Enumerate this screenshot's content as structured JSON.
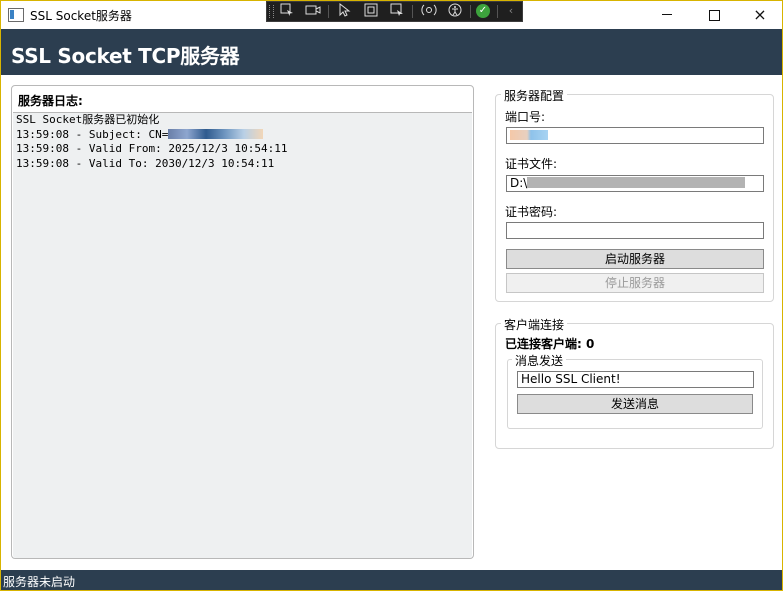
{
  "window": {
    "title": "SSL Socket服务器",
    "controls": {
      "minimize": "minimize-icon",
      "maximize": "maximize-icon",
      "close": "×"
    }
  },
  "debug_toolbar": {
    "icons": [
      "select-element-icon",
      "video-icon",
      "pointer-icon",
      "bounds-icon",
      "track-focus-icon",
      "hot-reload-icon",
      "accessibility-icon",
      "check-icon",
      "chevron-left-icon"
    ]
  },
  "header": {
    "title": "SSL Socket TCP服务器"
  },
  "log": {
    "label": "服务器日志:",
    "lines": [
      "SSL Socket服务器已初始化",
      "13:59:08 - Subject: CN=",
      "13:59:08 - Valid From: 2025/12/3 10:54:11",
      "13:59:08 - Valid To: 2030/12/3 10:54:11"
    ]
  },
  "server_config": {
    "title": "服务器配置",
    "port_label": "端口号:",
    "cert_file_label": "证书文件:",
    "cert_file_value": "D:\\",
    "cert_password_label": "证书密码:",
    "start_label": "启动服务器",
    "stop_label": "停止服务器"
  },
  "client": {
    "title": "客户端连接",
    "connected_label": "已连接客户端: 0",
    "message_group_title": "消息发送",
    "message_value": "Hello SSL Client!",
    "send_label": "发送消息"
  },
  "status": {
    "text": "服务器未启动"
  },
  "colors": {
    "header_bg": "#2c3e50",
    "status_bg": "#2c3e50",
    "log_bg": "#eef0f1",
    "button_bg": "#dddddd",
    "window_border": "#d8b400"
  }
}
